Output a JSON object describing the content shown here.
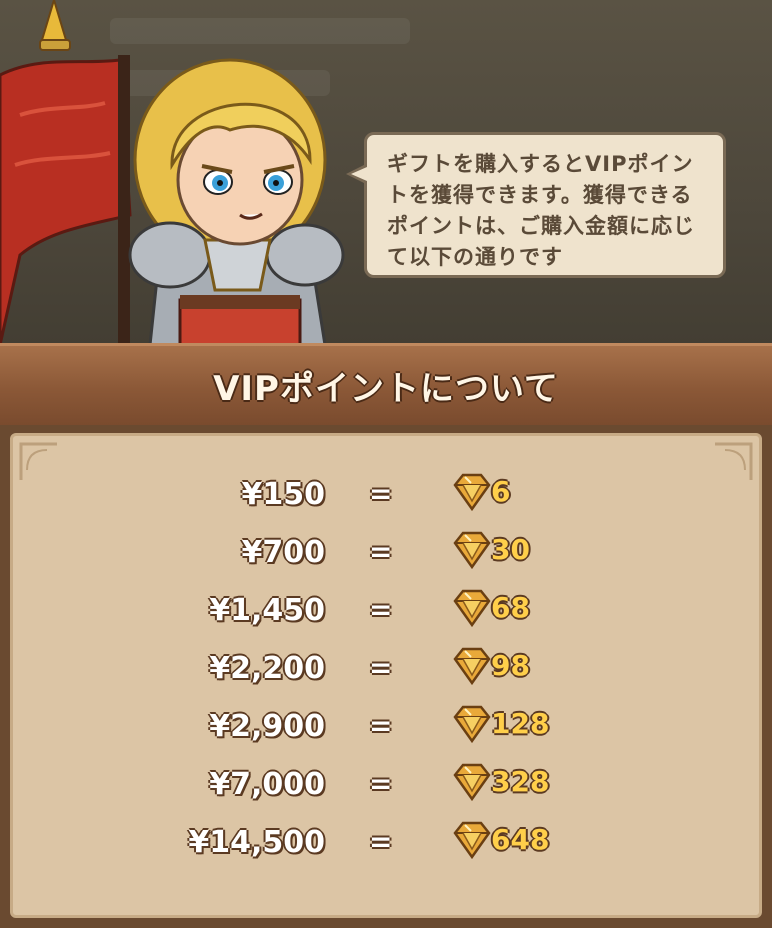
{
  "speech": {
    "text": "ギフトを購入するとVIPポイントを獲得できます。獲得できるポイントは、ご購入金額に応じて以下の通りです"
  },
  "panel": {
    "title": "VIPポイントについて"
  },
  "rates": [
    {
      "price": "¥150",
      "equals": "=",
      "points": "6",
      "icon": "vip-gem-icon"
    },
    {
      "price": "¥700",
      "equals": "=",
      "points": "30",
      "icon": "vip-gem-icon"
    },
    {
      "price": "¥1,450",
      "equals": "=",
      "points": "68",
      "icon": "vip-gem-icon"
    },
    {
      "price": "¥2,200",
      "equals": "=",
      "points": "98",
      "icon": "vip-gem-icon"
    },
    {
      "price": "¥2,900",
      "equals": "=",
      "points": "128",
      "icon": "vip-gem-icon"
    },
    {
      "price": "¥7,000",
      "equals": "=",
      "points": "328",
      "icon": "vip-gem-icon"
    },
    {
      "price": "¥14,500",
      "equals": "=",
      "points": "648",
      "icon": "vip-gem-icon"
    }
  ],
  "colors": {
    "header_wood": "#8b5837",
    "panel_paper": "#dcc5a5",
    "points_gold": "#ffcf4a",
    "bubble_bg": "#efe3cd"
  }
}
